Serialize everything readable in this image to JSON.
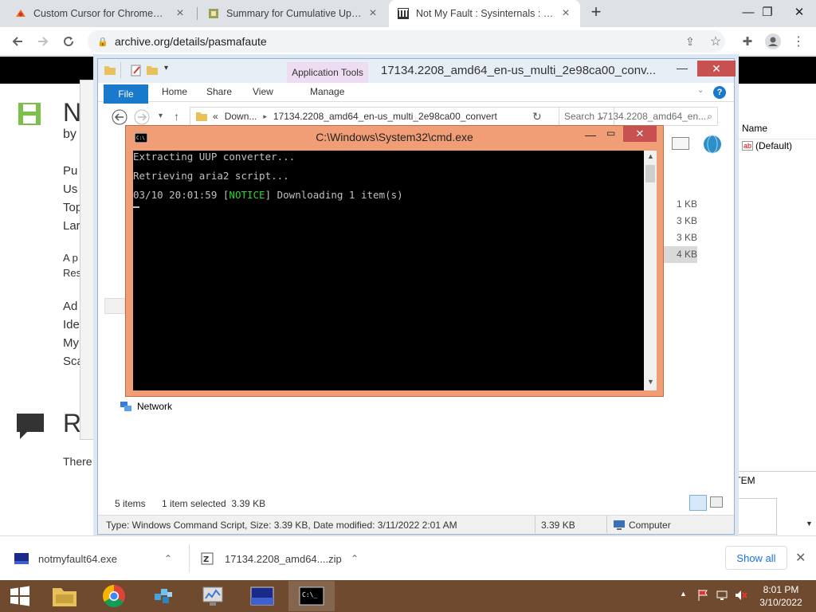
{
  "browser": {
    "tabs": [
      {
        "title": "Custom Cursor for Chrome™ - C"
      },
      {
        "title": "Summary for Cumulative Update"
      },
      {
        "title": "Not My Fault : Sysinternals : Free"
      }
    ],
    "new_tab_icon": "plus-icon",
    "address": "archive.org/details/pasmafaute"
  },
  "page": {
    "headings": [
      "N",
      "R"
    ],
    "by": "by",
    "left_lines": [
      "Pu",
      "Us",
      "Top",
      "Lar",
      "A p",
      "Res",
      "Ad",
      "Ide",
      "My",
      "Sca"
    ],
    "there": "There a"
  },
  "explorer": {
    "context_tab": "Application Tools",
    "title": "17134.2208_amd64_en-us_multi_2e98ca00_conv...",
    "ribbon_tabs": [
      "File",
      "Home",
      "Share",
      "View",
      "Manage"
    ],
    "address_prefix": "«",
    "address_parts": [
      "Down...",
      "17134.2208_amd64_en-us_multi_2e98ca00_convert"
    ],
    "search_placeholder": "Search 17134.2208_amd64_en...",
    "sizes": [
      "1 KB",
      "3 KB",
      "3 KB",
      "4 KB"
    ],
    "network_label": "Network",
    "status_items": "5 items",
    "status_selected": "1 item selected  3.39 KB",
    "detail_text": "Type: Windows Command Script, Size: 3.39 KB, Date modified: 3/11/2022 2:01 AM",
    "detail_size": "3.39 KB",
    "detail_location": "Computer"
  },
  "registry": {
    "column_name": "Name",
    "default_value": "(Default)",
    "item_label": "ITEM"
  },
  "cmd": {
    "title": "C:\\Windows\\System32\\cmd.exe",
    "line1": "Extracting UUP converter...",
    "line2": "Retrieving aria2 script...",
    "line3_pre": "03/10 20:01:59 [",
    "line3_notice": "NOTICE",
    "line3_post": "] Downloading 1 item(s)"
  },
  "downloads": {
    "items": [
      {
        "name": "notmyfault64.exe"
      },
      {
        "name": "17134.2208_amd64....zip"
      }
    ],
    "show_all": "Show all"
  },
  "taskbar": {
    "time": "8:01 PM",
    "date": "3/10/2022"
  }
}
